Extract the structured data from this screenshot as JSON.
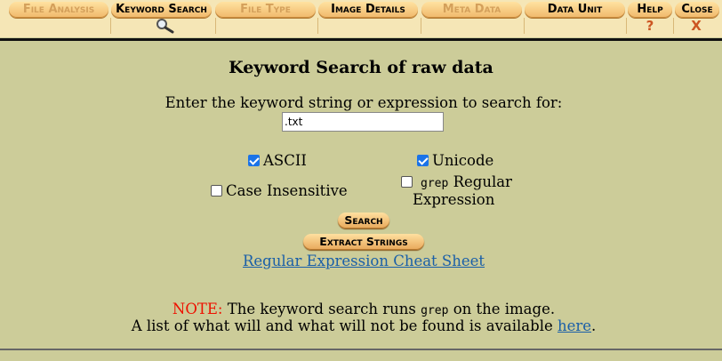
{
  "tabs": [
    {
      "label": "File Analysis",
      "active": false
    },
    {
      "label": "Keyword Search",
      "active": true
    },
    {
      "label": "File Type",
      "active": false
    },
    {
      "label": "Image Details",
      "active": true
    },
    {
      "label": "Meta Data",
      "active": false
    },
    {
      "label": "Data Unit",
      "active": true
    },
    {
      "label": "Help",
      "active": true
    },
    {
      "label": "Close",
      "active": true
    }
  ],
  "tab_icons": {
    "keyword_search": "magnifier-icon",
    "help": "?",
    "close": "X"
  },
  "main": {
    "title": "Keyword Search of raw data",
    "prompt": "Enter the keyword string or expression to search for:",
    "search_value": ".txt",
    "options": {
      "ascii": {
        "label": "ASCII",
        "checked": true
      },
      "unicode": {
        "label": "Unicode",
        "checked": true
      },
      "case_insensitive": {
        "label": "Case Insensitive",
        "checked": false
      },
      "grep_regex": {
        "prefix": "grep",
        "label_line1": "Regular",
        "label_line2": "Expression",
        "checked": false
      }
    },
    "search_button": "Search",
    "extract_button": "Extract Strings",
    "cheat_sheet_link": "Regular Expression Cheat Sheet",
    "note": {
      "label": "NOTE:",
      "text_before": "The keyword search runs",
      "code": "grep",
      "text_after": "on the image.",
      "line2_before": "A list of what will and what will not be found is available",
      "line2_link": "here",
      "line2_after": "."
    }
  },
  "colors": {
    "background": "#cccc99",
    "tab_bar": "#f5e6b6",
    "note_red": "#ee1100",
    "link_blue": "#1a5fa8",
    "checkbox_blue": "#1a73e8"
  }
}
